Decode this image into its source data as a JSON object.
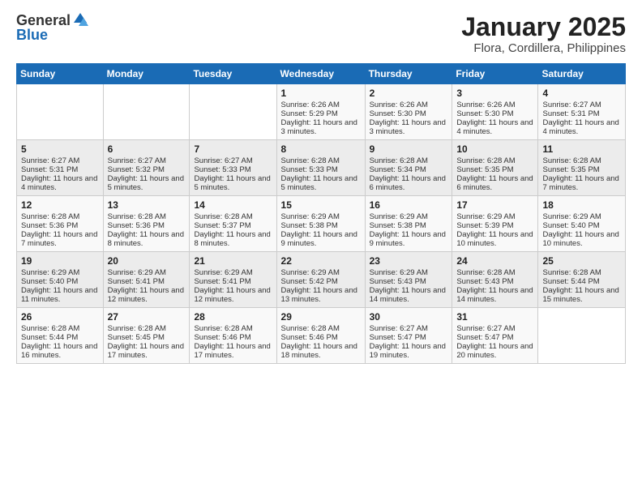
{
  "header": {
    "logo_general": "General",
    "logo_blue": "Blue",
    "month": "January 2025",
    "location": "Flora, Cordillera, Philippines"
  },
  "weekdays": [
    "Sunday",
    "Monday",
    "Tuesday",
    "Wednesday",
    "Thursday",
    "Friday",
    "Saturday"
  ],
  "weeks": [
    [
      {
        "day": "",
        "info": ""
      },
      {
        "day": "",
        "info": ""
      },
      {
        "day": "",
        "info": ""
      },
      {
        "day": "1",
        "info": "Sunrise: 6:26 AM\nSunset: 5:29 PM\nDaylight: 11 hours and 3 minutes."
      },
      {
        "day": "2",
        "info": "Sunrise: 6:26 AM\nSunset: 5:30 PM\nDaylight: 11 hours and 3 minutes."
      },
      {
        "day": "3",
        "info": "Sunrise: 6:26 AM\nSunset: 5:30 PM\nDaylight: 11 hours and 4 minutes."
      },
      {
        "day": "4",
        "info": "Sunrise: 6:27 AM\nSunset: 5:31 PM\nDaylight: 11 hours and 4 minutes."
      }
    ],
    [
      {
        "day": "5",
        "info": "Sunrise: 6:27 AM\nSunset: 5:31 PM\nDaylight: 11 hours and 4 minutes."
      },
      {
        "day": "6",
        "info": "Sunrise: 6:27 AM\nSunset: 5:32 PM\nDaylight: 11 hours and 5 minutes."
      },
      {
        "day": "7",
        "info": "Sunrise: 6:27 AM\nSunset: 5:33 PM\nDaylight: 11 hours and 5 minutes."
      },
      {
        "day": "8",
        "info": "Sunrise: 6:28 AM\nSunset: 5:33 PM\nDaylight: 11 hours and 5 minutes."
      },
      {
        "day": "9",
        "info": "Sunrise: 6:28 AM\nSunset: 5:34 PM\nDaylight: 11 hours and 6 minutes."
      },
      {
        "day": "10",
        "info": "Sunrise: 6:28 AM\nSunset: 5:35 PM\nDaylight: 11 hours and 6 minutes."
      },
      {
        "day": "11",
        "info": "Sunrise: 6:28 AM\nSunset: 5:35 PM\nDaylight: 11 hours and 7 minutes."
      }
    ],
    [
      {
        "day": "12",
        "info": "Sunrise: 6:28 AM\nSunset: 5:36 PM\nDaylight: 11 hours and 7 minutes."
      },
      {
        "day": "13",
        "info": "Sunrise: 6:28 AM\nSunset: 5:36 PM\nDaylight: 11 hours and 8 minutes."
      },
      {
        "day": "14",
        "info": "Sunrise: 6:28 AM\nSunset: 5:37 PM\nDaylight: 11 hours and 8 minutes."
      },
      {
        "day": "15",
        "info": "Sunrise: 6:29 AM\nSunset: 5:38 PM\nDaylight: 11 hours and 9 minutes."
      },
      {
        "day": "16",
        "info": "Sunrise: 6:29 AM\nSunset: 5:38 PM\nDaylight: 11 hours and 9 minutes."
      },
      {
        "day": "17",
        "info": "Sunrise: 6:29 AM\nSunset: 5:39 PM\nDaylight: 11 hours and 10 minutes."
      },
      {
        "day": "18",
        "info": "Sunrise: 6:29 AM\nSunset: 5:40 PM\nDaylight: 11 hours and 10 minutes."
      }
    ],
    [
      {
        "day": "19",
        "info": "Sunrise: 6:29 AM\nSunset: 5:40 PM\nDaylight: 11 hours and 11 minutes."
      },
      {
        "day": "20",
        "info": "Sunrise: 6:29 AM\nSunset: 5:41 PM\nDaylight: 11 hours and 12 minutes."
      },
      {
        "day": "21",
        "info": "Sunrise: 6:29 AM\nSunset: 5:41 PM\nDaylight: 11 hours and 12 minutes."
      },
      {
        "day": "22",
        "info": "Sunrise: 6:29 AM\nSunset: 5:42 PM\nDaylight: 11 hours and 13 minutes."
      },
      {
        "day": "23",
        "info": "Sunrise: 6:29 AM\nSunset: 5:43 PM\nDaylight: 11 hours and 14 minutes."
      },
      {
        "day": "24",
        "info": "Sunrise: 6:28 AM\nSunset: 5:43 PM\nDaylight: 11 hours and 14 minutes."
      },
      {
        "day": "25",
        "info": "Sunrise: 6:28 AM\nSunset: 5:44 PM\nDaylight: 11 hours and 15 minutes."
      }
    ],
    [
      {
        "day": "26",
        "info": "Sunrise: 6:28 AM\nSunset: 5:44 PM\nDaylight: 11 hours and 16 minutes."
      },
      {
        "day": "27",
        "info": "Sunrise: 6:28 AM\nSunset: 5:45 PM\nDaylight: 11 hours and 17 minutes."
      },
      {
        "day": "28",
        "info": "Sunrise: 6:28 AM\nSunset: 5:46 PM\nDaylight: 11 hours and 17 minutes."
      },
      {
        "day": "29",
        "info": "Sunrise: 6:28 AM\nSunset: 5:46 PM\nDaylight: 11 hours and 18 minutes."
      },
      {
        "day": "30",
        "info": "Sunrise: 6:27 AM\nSunset: 5:47 PM\nDaylight: 11 hours and 19 minutes."
      },
      {
        "day": "31",
        "info": "Sunrise: 6:27 AM\nSunset: 5:47 PM\nDaylight: 11 hours and 20 minutes."
      },
      {
        "day": "",
        "info": ""
      }
    ]
  ]
}
